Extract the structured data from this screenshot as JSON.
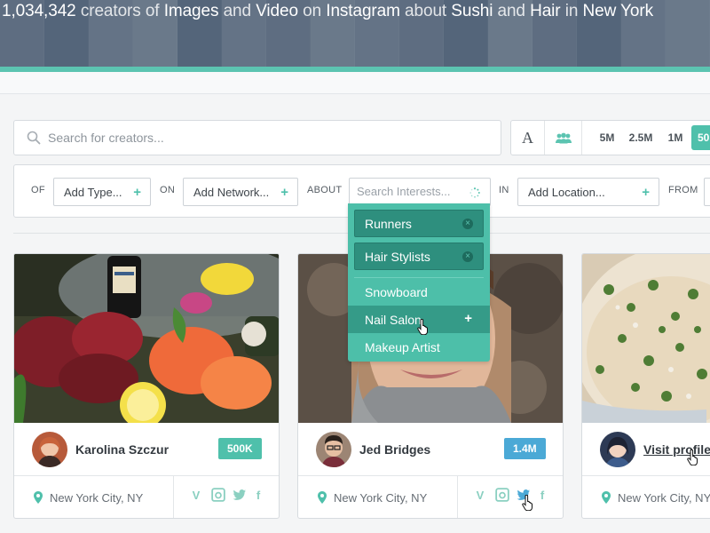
{
  "header": {
    "count": "1,034,342",
    "t1": "creators of",
    "kind1": "Images",
    "t2": "and",
    "kind2": "Video",
    "t3": "on",
    "network": "Instagram",
    "t4": "about",
    "topic1": "Sushi",
    "t5": "and",
    "topic2": "Hair",
    "t6": "in",
    "place": "New York"
  },
  "search": {
    "placeholder": "Search for creators..."
  },
  "toolbar": {
    "text_mode_label": "A",
    "reach_options": [
      "5M",
      "2.5M",
      "1M",
      "50"
    ],
    "active_reach": "50"
  },
  "filters": {
    "of_label": "OF",
    "type_button": "Add Type...",
    "on_label": "ON",
    "network_button": "Add Network...",
    "about_label": "ABOUT",
    "interest_placeholder": "Search Interests...",
    "in_label": "IN",
    "location_button": "Add Location...",
    "from_label": "FROM"
  },
  "interest_dropdown": {
    "selected": [
      "Runners",
      "Hair Stylists"
    ],
    "options": [
      "Snowboard",
      "Nail Salon",
      "Makeup Artist"
    ],
    "hovered": "Nail Salon"
  },
  "creators": [
    {
      "name": "Karolina Szczur",
      "badge": "500K",
      "badge_color": "#4fc0ab",
      "location": "New York City, NY"
    },
    {
      "name": "Jed Bridges",
      "badge": "1.4M",
      "badge_color": "#4ba9d6",
      "location": "New York City, NY"
    },
    {
      "name": "",
      "link": "Visit profile...",
      "location": "New York City, NY"
    }
  ],
  "colors": {
    "accent": "#4fc0ab",
    "accent_dark": "#2e8f7e",
    "blue": "#4ba9d6"
  }
}
